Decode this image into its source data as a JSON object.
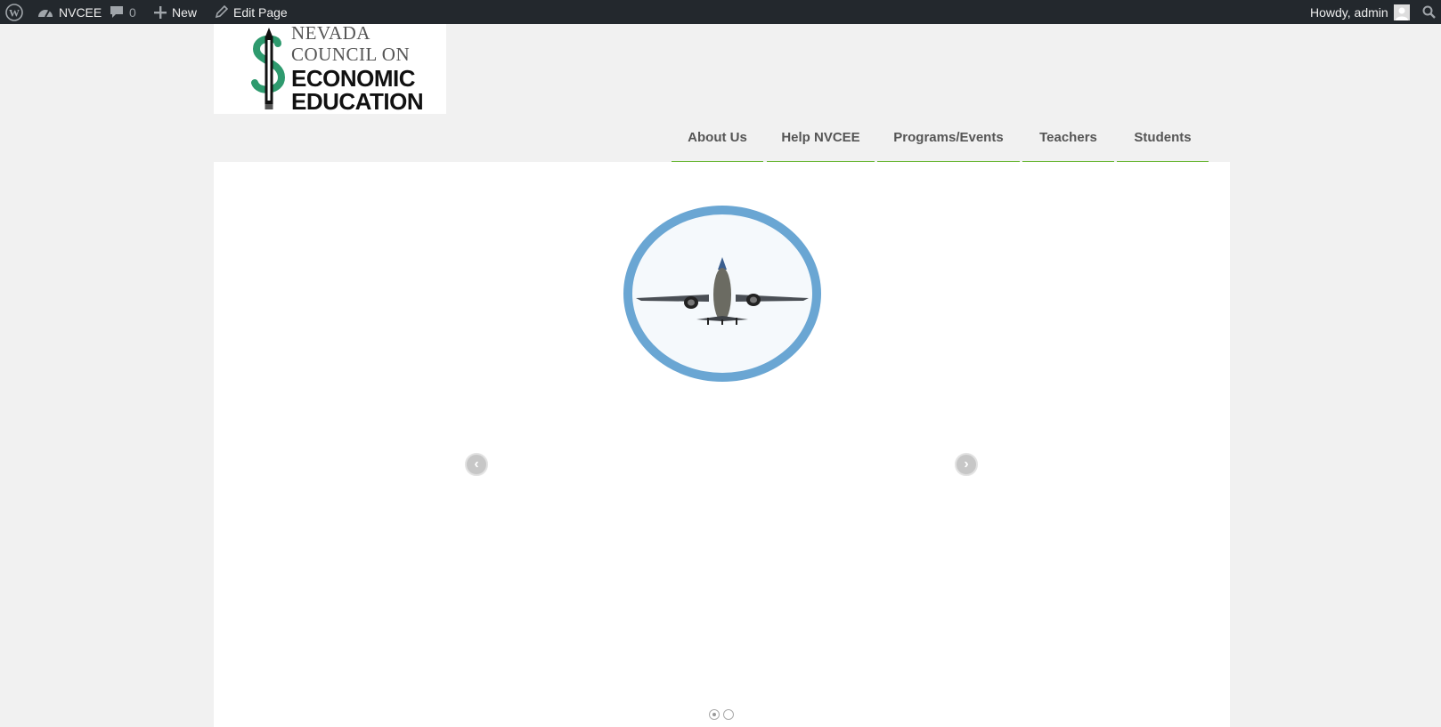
{
  "adminbar": {
    "site_name": "NVCEE",
    "comments_count": "0",
    "new_label": "New",
    "edit_label": "Edit Page",
    "howdy": "Howdy, admin"
  },
  "logo": {
    "line1": "NEVADA",
    "line2": "COUNCIL ON",
    "line3": "ECONOMIC",
    "line4": "EDUCATION"
  },
  "nav": {
    "items": [
      {
        "label": "About Us"
      },
      {
        "label": "Help NVCEE"
      },
      {
        "label": "Programs/Events"
      },
      {
        "label": "Teachers"
      },
      {
        "label": "Students"
      }
    ]
  },
  "slider": {
    "prev_icon": "‹",
    "next_icon": "›",
    "slide_count": 2,
    "active_slide": 1
  },
  "colors": {
    "accent_green": "#6bb837",
    "ring_blue": "#6aa6d3",
    "adminbar_bg": "#23282d"
  }
}
